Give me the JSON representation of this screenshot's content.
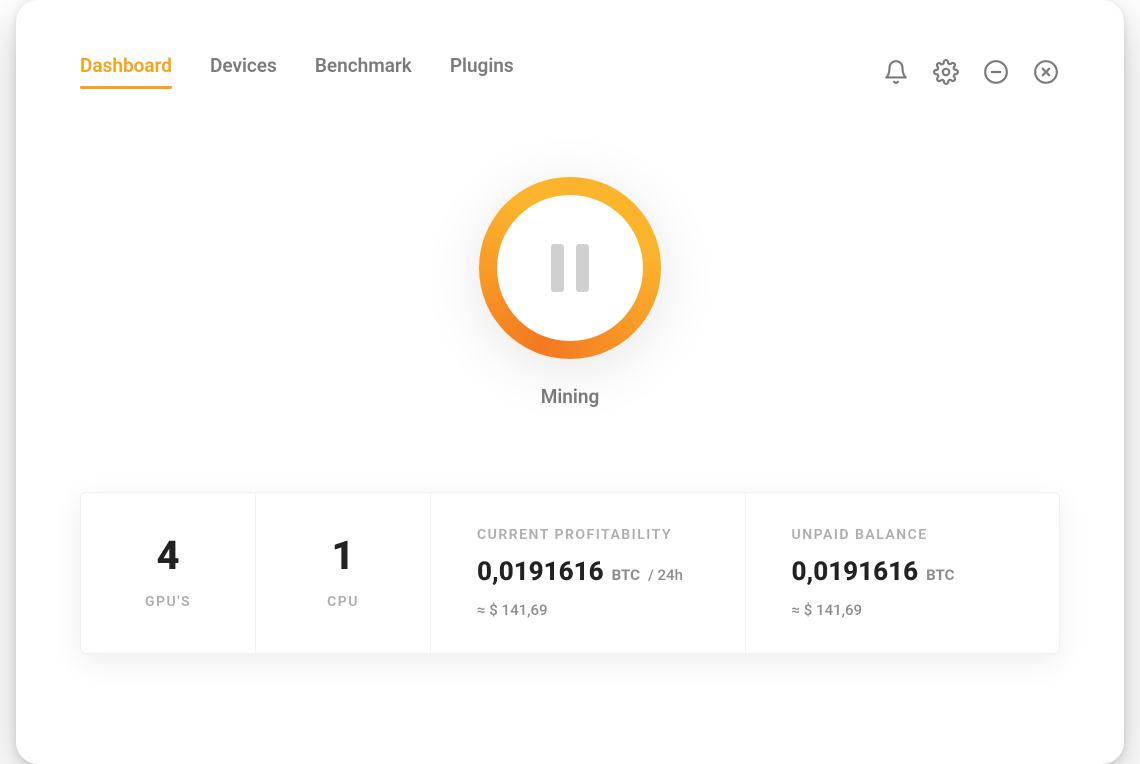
{
  "tabs": {
    "dashboard": "Dashboard",
    "devices": "Devices",
    "benchmark": "Benchmark",
    "plugins": "Plugins"
  },
  "mining": {
    "status_label": "Mining"
  },
  "stats": {
    "gpu_count": "4",
    "gpu_label": "GPU'S",
    "cpu_count": "1",
    "cpu_label": "CPU",
    "profitability": {
      "title": "CURRENT PROFITABILITY",
      "amount": "0,0191616",
      "unit": "BTC",
      "per": "/ 24h",
      "approx": "≈ $ 141,69"
    },
    "balance": {
      "title": "UNPAID BALANCE",
      "amount": "0,0191616",
      "unit": "BTC",
      "approx": "≈ $ 141,69"
    }
  },
  "colors": {
    "accent": "#f9a11b"
  }
}
